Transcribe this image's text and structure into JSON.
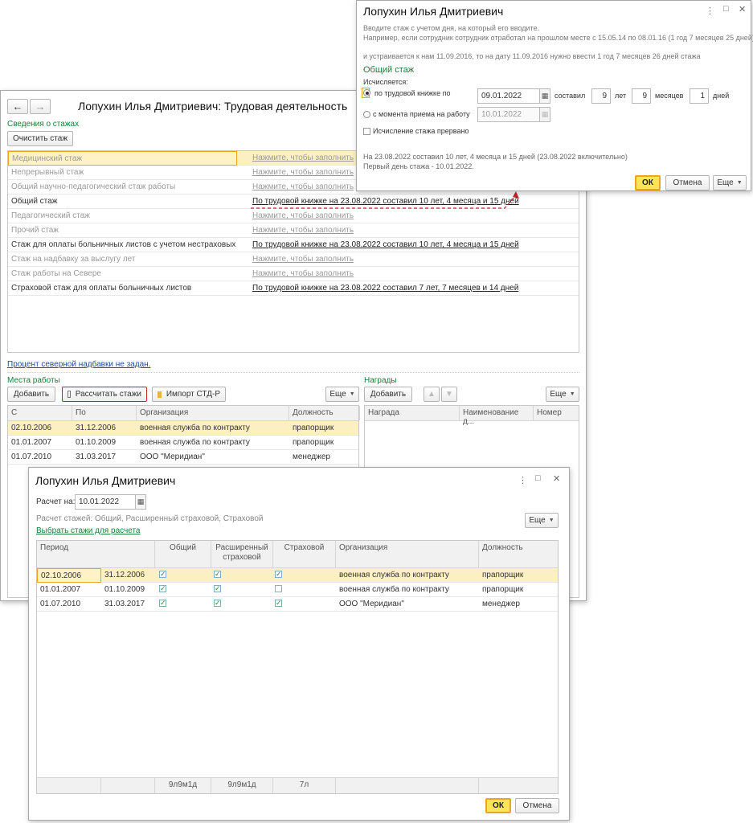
{
  "main": {
    "title": "Лопухин Илья Дмитриевич: Трудовая деятельность",
    "nav_back": "←",
    "nav_forward": "→",
    "stazh_header": "Сведения о стажах",
    "clear_button": "Очистить стаж",
    "stazh_rows": [
      {
        "name": "Медицинский стаж",
        "value": "Нажмите, чтобы заполнить",
        "filled": false
      },
      {
        "name": "Непрерывный стаж",
        "value": "Нажмите, чтобы заполнить",
        "filled": false
      },
      {
        "name": "Общий научно-педагогический стаж работы",
        "value": "Нажмите, чтобы заполнить",
        "filled": false
      },
      {
        "name": "Общий стаж",
        "value": "По трудовой книжке на 23.08.2022 составил 10 лет, 4 месяца и 15 дней",
        "filled": true
      },
      {
        "name": "Педагогический стаж",
        "value": "Нажмите, чтобы заполнить",
        "filled": false
      },
      {
        "name": "Прочий стаж",
        "value": "Нажмите, чтобы заполнить",
        "filled": false
      },
      {
        "name": "Стаж для оплаты больничных листов с учетом нестраховых п...",
        "value": "По трудовой книжке на 23.08.2022 составил 10 лет, 4 месяца и 15 дней",
        "filled": true
      },
      {
        "name": "Стаж на надбавку за выслугу лет",
        "value": "Нажмите, чтобы заполнить",
        "filled": false
      },
      {
        "name": "Стаж работы на Севере",
        "value": "Нажмите, чтобы заполнить",
        "filled": false
      },
      {
        "name": "Страховой стаж для оплаты больничных листов",
        "value": "По трудовой книжке на 23.08.2022 составил 7 лет, 7 месяцев и 14 дней",
        "filled": true
      }
    ],
    "northern_link": "Процент северной надбавки не задан.",
    "workplaces_header": "Места работы",
    "add_button": "Добавить",
    "calc_button": "Рассчитать стажи",
    "import_button": "Импорт СТД-Р",
    "more_button": "Еще",
    "work_columns": [
      "С",
      "По",
      "Организация",
      "Должность"
    ],
    "work_rows": [
      {
        "from": "02.10.2006",
        "to": "31.12.2006",
        "org": "военная служба по контракту",
        "pos": "прапорщик"
      },
      {
        "from": "01.01.2007",
        "to": "01.10.2009",
        "org": "военная служба по контракту",
        "pos": "прапорщик"
      },
      {
        "from": "01.07.2010",
        "to": "31.03.2017",
        "org": "ООО \"Меридиан\"",
        "pos": "менеджер"
      }
    ],
    "awards_header": "Награды",
    "awards_add": "Добавить",
    "awards_more": "Еще",
    "awards_columns": [
      "Награда",
      "Наименование д...",
      "Номер"
    ]
  },
  "stazh_dialog": {
    "title": "Лопухин Илья Дмитриевич",
    "hint1": "Вводите стаж с учетом дня, на который его вводите.",
    "hint2": "Например, если сотрудник сотрудник отработал на прошлом месте с 15.05.14 по 08.01.16 (1 год 7 месяцев 25 дней)",
    "hint3": "и устраивается к нам 11.09.2016, то на дату 11.09.2016 нужно ввести 1 год 7 месяцев 26 дней стажа",
    "section": "Общий стаж",
    "calc_label": "Исчисляется:",
    "radio1": "по трудовой книжке по",
    "date1": "09.01.2022",
    "sostavil": "составил",
    "years": "9",
    "years_label": "лет",
    "months": "9",
    "months_label": "месяцев",
    "days": "1",
    "days_label": "дней",
    "radio2": "с момента приема на работу",
    "date2": "10.01.2022",
    "interrupted": "Исчисление стажа прервано",
    "result1": "На 23.08.2022 составил 10 лет, 4 месяца и 15 дней (23.08.2022 включительно)",
    "result2": "Первый день стажа - 10.01.2022.",
    "ok": "ОК",
    "cancel": "Отмена",
    "more": "Еще"
  },
  "calc_dialog": {
    "title": "Лопухин Илья Дмитриевич",
    "calc_on_label": "Расчет на:",
    "calc_on_date": "10.01.2022",
    "calc_types": "Расчет стажей: Общий, Расширенный страховой, Страховой",
    "choose_link": "Выбрать стажи для расчета",
    "more": "Еще",
    "columns": {
      "period": "Период",
      "general": "Общий",
      "extended_1": "Расширенный",
      "extended_2": "страховой",
      "insurance": "Страховой",
      "org": "Организация",
      "position": "Должность"
    },
    "rows": [
      {
        "from": "02.10.2006",
        "to": "31.12.2006",
        "general": true,
        "extended": true,
        "insurance": true,
        "org": "военная служба по контракту",
        "pos": "прапорщик"
      },
      {
        "from": "01.01.2007",
        "to": "01.10.2009",
        "general": true,
        "extended": true,
        "insurance": false,
        "org": "военная служба по контракту",
        "pos": "прапорщик"
      },
      {
        "from": "01.07.2010",
        "to": "31.03.2017",
        "general": true,
        "extended": true,
        "insurance": true,
        "org": "ООО \"Меридиан\"",
        "pos": "менеджер"
      }
    ],
    "totals": {
      "general": "9л9м1д",
      "extended": "9л9м1д",
      "insurance": "7л"
    },
    "ok": "ОК",
    "cancel": "Отмена"
  },
  "colors": {
    "accent_green": "#1f7a3a",
    "ok_yellow": "#ffe45a",
    "selection": "#fcf0c2",
    "link_red": "#c0272d"
  }
}
